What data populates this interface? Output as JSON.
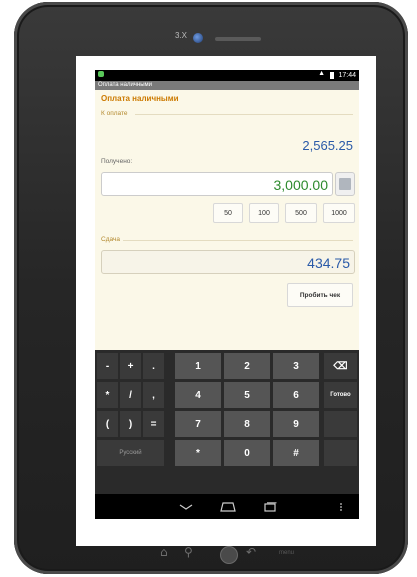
{
  "device": {
    "camera_label": "3.X",
    "hw_buttons": {
      "menu_label": "menu"
    }
  },
  "statusbar": {
    "time": "17:44"
  },
  "app": {
    "title_bar": "Оплата наличными",
    "form_title": "Оплата наличными",
    "amount_due": {
      "label": "К оплате",
      "value": "2,565.25"
    },
    "received": {
      "label": "Получено:",
      "value": "3,000.00"
    },
    "quick_amounts": [
      "50",
      "100",
      "500",
      "1000"
    ],
    "change": {
      "label": "Сдача",
      "value": "434.75"
    },
    "receipt_button": "Пробить чек"
  },
  "keyboard": {
    "row1": [
      "-",
      "+",
      ".",
      "1",
      "2",
      "3"
    ],
    "row2": [
      "*",
      "/",
      ",",
      "4",
      "5",
      "6"
    ],
    "row3": [
      "(",
      ")",
      "=",
      "7",
      "8",
      "9"
    ],
    "row4": [
      "Русский",
      "*",
      "0",
      "#"
    ],
    "done_label": "Готово"
  },
  "colors": {
    "form_title": "#cc7a00",
    "amount_due": "#2a5aa8",
    "received": "#2d8a2d",
    "change": "#2a5aa8",
    "background": "#fbf8e8"
  }
}
